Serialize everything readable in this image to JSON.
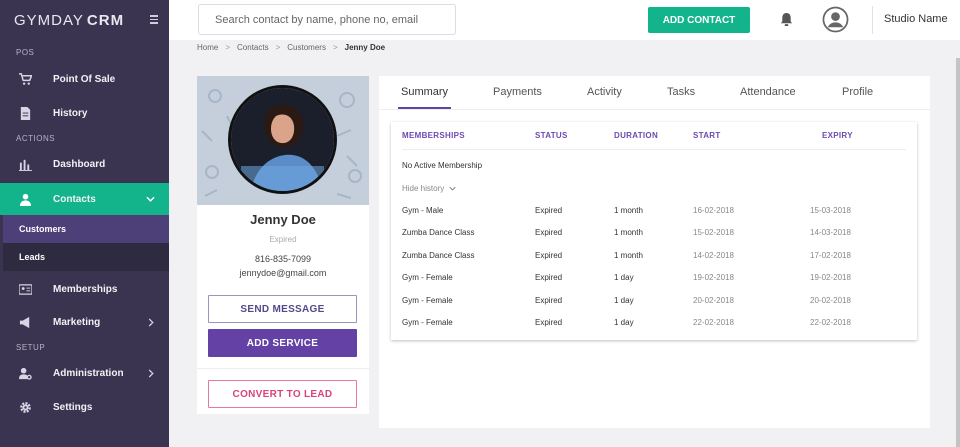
{
  "brand": {
    "name_light": "GYMDAY",
    "name_bold": "CRM"
  },
  "sidebar": {
    "sections": {
      "pos": "POS",
      "actions": "ACTIONS",
      "setup": "SETUP"
    },
    "items": {
      "point_of_sale": "Point Of Sale",
      "history": "History",
      "dashboard": "Dashboard",
      "contacts": "Contacts",
      "customers": "Customers",
      "leads": "Leads",
      "memberships": "Memberships",
      "marketing": "Marketing",
      "administration": "Administration",
      "settings": "Settings"
    },
    "active_color": "#13b48c"
  },
  "topbar": {
    "search_placeholder": "Search contact by name, phone no, email",
    "add_contact": "ADD CONTACT",
    "studio_name": "Studio Name"
  },
  "breadcrumb": [
    "Home",
    "Contacts",
    "Customers",
    "Jenny Doe"
  ],
  "profile": {
    "name": "Jenny Doe",
    "status": "Expired",
    "phone": "816-835-7099",
    "email": "jennydoe@gmail.com",
    "send_message": "SEND MESSAGE",
    "add_service": "ADD SERVICE",
    "convert_to_lead": "CONVERT TO LEAD"
  },
  "tabs": [
    "Summary",
    "Payments",
    "Activity",
    "Tasks",
    "Attendance",
    "Profile"
  ],
  "memberships": {
    "headers": [
      "MEMBERSHIPS",
      "STATUS",
      "DURATION",
      "START",
      "EXPIRY"
    ],
    "no_active": "No Active Membership",
    "hide_history": "Hide history",
    "rows": [
      [
        "Gym - Male",
        "Expired",
        "1 month",
        "16-02-2018",
        "15-03-2018"
      ],
      [
        "Zumba Dance Class",
        "Expired",
        "1 month",
        "15-02-2018",
        "14-03-2018"
      ],
      [
        "Zumba Dance Class",
        "Expired",
        "1 month",
        "14-02-2018",
        "17-02-2018"
      ],
      [
        "Gym - Female",
        "Expired",
        "1 day",
        "19-02-2018",
        "19-02-2018"
      ],
      [
        "Gym - Female",
        "Expired",
        "1 day",
        "20-02-2018",
        "20-02-2018"
      ],
      [
        "Gym - Female",
        "Expired",
        "1 day",
        "22-02-2018",
        "22-02-2018"
      ]
    ]
  }
}
